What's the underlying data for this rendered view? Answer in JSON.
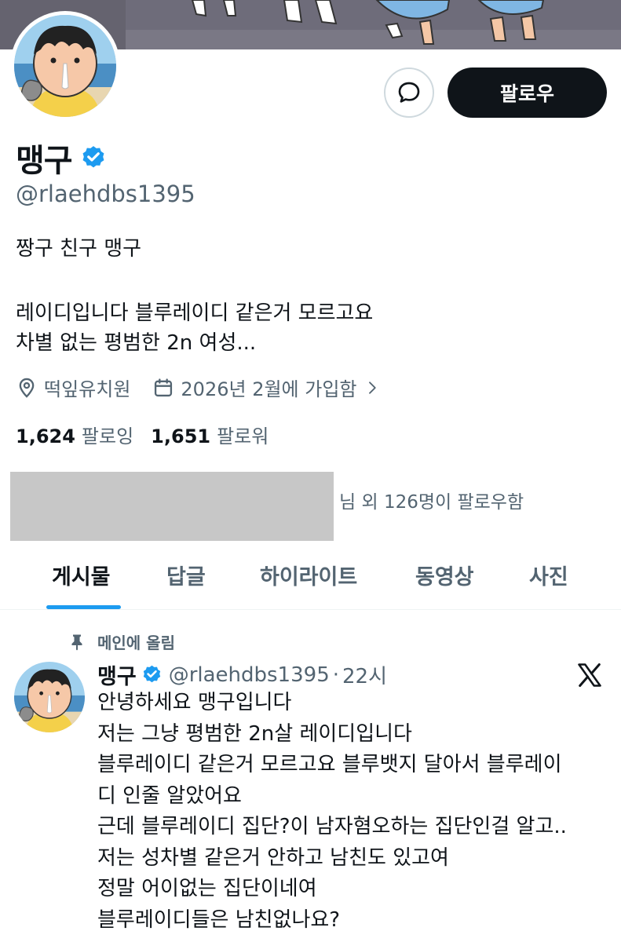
{
  "profile": {
    "display_name": "맹구",
    "handle": "@rlaehdbs1395",
    "follow_label": "팔로우",
    "bio_lines": [
      "짱구 친구 맹구",
      "레이디입니다 블루레이디 같은거 모르고요",
      "차별 없는 평범한 2n 여성..."
    ],
    "location": "떡잎유치원",
    "joined": "2026년 2월에 가입함",
    "following_count": "1,624",
    "following_label": "팔로잉",
    "followers_count": "1,651",
    "followers_label": "팔로워",
    "followed_by": "님 외 126명이 팔로우함"
  },
  "tabs": [
    {
      "label": "게시물",
      "active": true
    },
    {
      "label": "답글",
      "active": false
    },
    {
      "label": "하이라이트",
      "active": false
    },
    {
      "label": "동영상",
      "active": false
    },
    {
      "label": "사진",
      "active": false
    }
  ],
  "tweet": {
    "pinned_label": "메인에 올림",
    "name": "맹구",
    "handle": "@rlaehdbs1395",
    "dot": "·",
    "time": "22시",
    "lines": [
      "안녕하세요 맹구입니다",
      "저는 그냥 평범한 2n살 레이디입니다",
      "블루레이디 같은거 모르고요 블루뱃지 달아서 블루레이",
      "디 인줄 알았어요",
      "근데 블루레이디 집단?이 남자혐오하는 집단인걸 알고..",
      "저는 성차별 같은거 안하고 남친도 있고여",
      "정말 어이없는 집단이네여",
      "블루레이디들은 남친없나요?"
    ]
  },
  "icons": {
    "message": "message-icon",
    "verified": "verified-badge-icon",
    "location": "location-pin-icon",
    "calendar": "calendar-icon",
    "chevron": "chevron-right-icon",
    "pin": "pin-icon",
    "x_logo": "x-logo-icon"
  },
  "colors": {
    "accent": "#1d9bf0",
    "follow_button_bg": "#0f1419",
    "secondary_text": "#536471",
    "redaction": "#c7c7c7"
  }
}
